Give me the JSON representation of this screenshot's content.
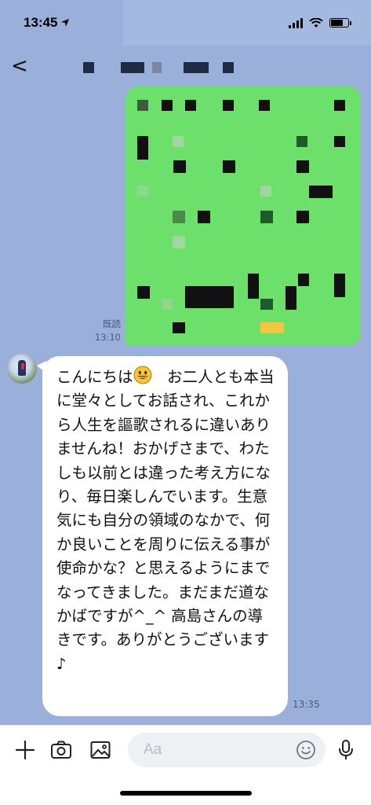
{
  "status_bar": {
    "time": "13:45"
  },
  "chat": {
    "sent": {
      "read_label": "既読",
      "time": "13:10"
    },
    "received": {
      "line1": "こんにちは",
      "line1b": "　お二人とも",
      "body": "本当に堂々としてお話され、これから人生を謳歌されるに違いありませんね！おかげさまで、わたしも以前とは違った考え方になり、毎日楽しんでいます。生意気にも自分の領域のなかで、何か良いことを周りに伝える事が使命かな？と思えるようにまでなってきました。まだまだ道なかばですが^_^ 高島さんの導きです。ありがとうございます♪",
      "time": "13:35"
    }
  },
  "composer": {
    "placeholder": "Aa"
  },
  "colors": {
    "chat_bg": "#9aafd9",
    "sent_bubble": "#6ce06a",
    "accent_yellow": "#f5c542"
  }
}
